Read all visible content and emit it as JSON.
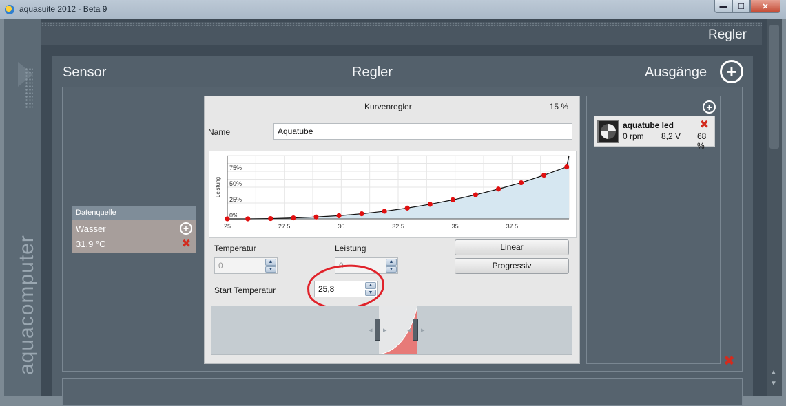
{
  "window": {
    "title": "aquasuite 2012 - Beta 9",
    "btn_min": "▬",
    "btn_max": "☐",
    "btn_close": "✕"
  },
  "brand": {
    "text": "aquacomputer"
  },
  "header": {
    "title": "Regler"
  },
  "columns": {
    "sensor": "Sensor",
    "controller": "Regler",
    "outputs": "Ausgänge",
    "add_symbol": "+"
  },
  "datasource": {
    "title": "Datenquelle",
    "name": "Wasser",
    "value": "31,9 °C",
    "add_symbol": "+",
    "remove_symbol": "✖"
  },
  "controller": {
    "title": "Kurvenregler",
    "percent": "15 %",
    "name_label": "Name",
    "name_value": "Aquatube",
    "temperature_label": "Temperatur",
    "temperature_value": "0",
    "power_label": "Leistung",
    "power_value": "0",
    "start_temp_label": "Start Temperatur",
    "start_temp_value": "25,8",
    "btn_linear": "Linear",
    "btn_progressive": "Progressiv",
    "spin_up": "▲",
    "spin_down": "▼",
    "slider_left_hint": "◂",
    "slider_right_hint": "▸"
  },
  "chart_data": {
    "type": "line",
    "ylabel": "Leistung",
    "xlabel": "",
    "xlim": [
      25,
      40
    ],
    "ylim": [
      0,
      100
    ],
    "x_ticks": [
      "25",
      "27.5",
      "30",
      "32.5",
      "35",
      "37.5"
    ],
    "x_tick_values": [
      25,
      27.5,
      30,
      32.5,
      35,
      37.5
    ],
    "y_ticks": [
      "0%",
      "25%",
      "50%",
      "75%"
    ],
    "y_tick_values": [
      0,
      25,
      50,
      75
    ],
    "points": [
      {
        "x": 25.0,
        "y": 0
      },
      {
        "x": 25.9,
        "y": 0
      },
      {
        "x": 26.9,
        "y": 0.5
      },
      {
        "x": 27.9,
        "y": 1.5
      },
      {
        "x": 28.9,
        "y": 3
      },
      {
        "x": 29.9,
        "y": 5
      },
      {
        "x": 30.9,
        "y": 8
      },
      {
        "x": 31.9,
        "y": 12
      },
      {
        "x": 32.9,
        "y": 17
      },
      {
        "x": 33.9,
        "y": 23
      },
      {
        "x": 34.9,
        "y": 30
      },
      {
        "x": 35.9,
        "y": 38
      },
      {
        "x": 36.9,
        "y": 47
      },
      {
        "x": 37.9,
        "y": 57
      },
      {
        "x": 38.9,
        "y": 69
      },
      {
        "x": 39.9,
        "y": 82
      }
    ],
    "grid": true,
    "fill": true,
    "line_color": "#111111",
    "point_color": "#e01010",
    "fill_color": "#d6e7f1"
  },
  "output": {
    "name": "aquatube led",
    "rpm": "0 rpm",
    "voltage": "8,2 V",
    "percent": "68 %",
    "remove_symbol": "✖",
    "add_symbol": "+"
  },
  "panel": {
    "remove_symbol": "✖"
  },
  "colors": {
    "accent_red": "#d32b1e",
    "annotation_red": "#e0232b",
    "curve_fill": "#d6e7f1"
  }
}
